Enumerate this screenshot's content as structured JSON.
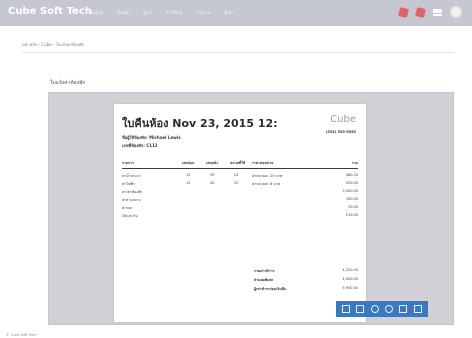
{
  "app": {
    "brand": "Cube Soft Tech"
  },
  "nav": {
    "links": [
      "หน้าหลัก",
      "ห้องพัก",
      "ผู้เช่า",
      "ค่าใช้จ่าย",
      "รายงาน",
      "ตั้งค่า"
    ]
  },
  "breadcrumb": {
    "text": "หน้าหลัก  ›  Cube  ›  ใบแจ้งค่าห้องพัก"
  },
  "section": {
    "title": "ใบแจ้งค่าห้องพัก"
  },
  "invoice": {
    "title": "ใบคืนห้อง Nov 23, 2015 12:",
    "brand": "Cube",
    "phone": "(555) 555-5555",
    "room_line": "ชื่อผู้ใช้ห้องพัก: Michael Lewis",
    "house_line": "เลขที่ห้องพัก: C112",
    "headers": [
      "รายการ",
      "เลขก่อน",
      "เลขหลัง",
      "หน่วยที่ใช้",
      "ราคาต่อหน่วย",
      "รวม"
    ],
    "rows": [
      [
        "ค่าน้ำประปา",
        "15",
        "39",
        "24",
        "คาหน่วยละ 20 บาท",
        "480.00"
      ],
      [
        "ค่าไฟฟ้า",
        "15",
        "40",
        "25",
        "คาหน่วยละ 8 บาท",
        "200.00"
      ],
      [
        "ค่าเช่าห้องพัก",
        "",
        "",
        "",
        "",
        "3,000.00"
      ],
      [
        "ค่าส่วนกลาง",
        "",
        "",
        "",
        "",
        "300.00"
      ],
      [
        "ค่าขยะ",
        "",
        "",
        "",
        "",
        "30.00"
      ],
      [
        "เงินประกัน",
        "",
        "",
        "",
        "",
        "210.00"
      ]
    ],
    "summary": [
      {
        "label": "รวมค่าบริการ",
        "value": "4,220.00"
      },
      {
        "label": "ส่วนลดพิเศษ",
        "value": "4,000.00"
      },
      {
        "label": "ผู้เช่าชำระก่อนเงินคืน",
        "value": "5,940.00"
      }
    ]
  },
  "toolbar": {
    "icons": [
      "page-icon",
      "frame-icon",
      "zoom-in-icon",
      "zoom-out-icon",
      "download-icon",
      "print-icon"
    ]
  },
  "footer": {
    "text": "© Cube Soft Tech"
  }
}
